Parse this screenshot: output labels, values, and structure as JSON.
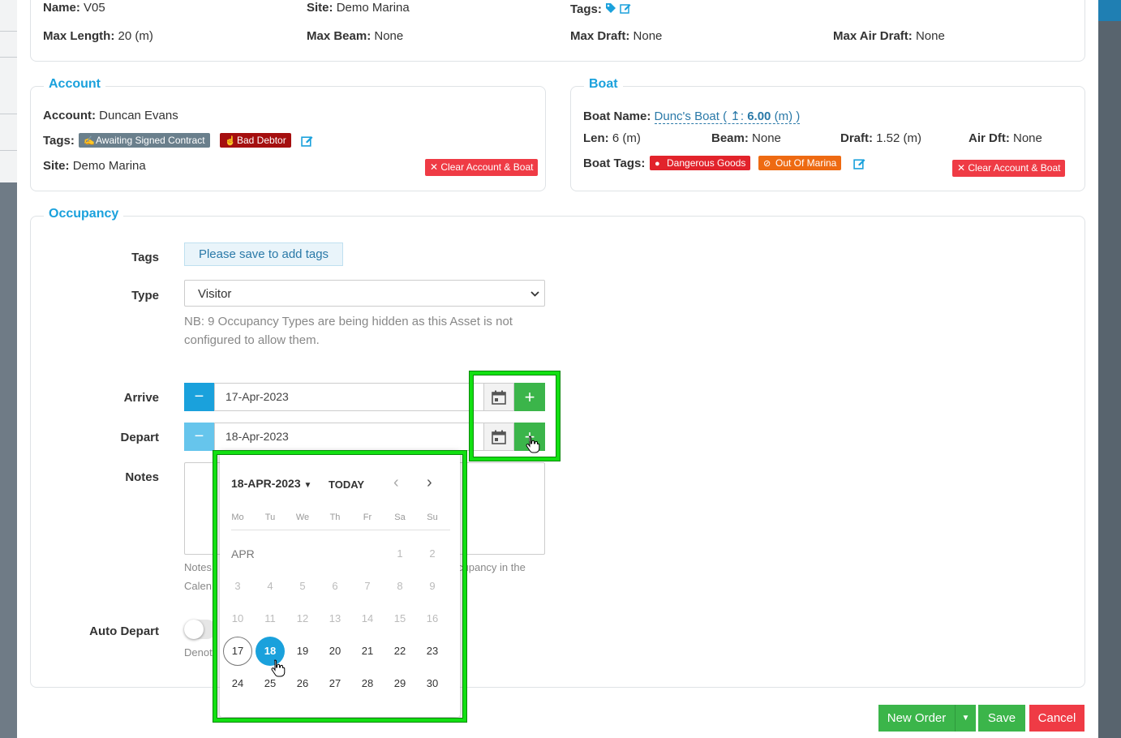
{
  "asset": {
    "name_label": "Name:",
    "name": "V05",
    "site_label": "Site:",
    "site": "Demo Marina",
    "tags_label": "Tags:",
    "max_length_label": "Max Length:",
    "max_length": "20 (m)",
    "max_beam_label": "Max Beam:",
    "max_beam": "None",
    "max_draft_label": "Max Draft:",
    "max_draft": "None",
    "max_air_draft_label": "Max Air Draft:",
    "max_air_draft": "None"
  },
  "account": {
    "legend": "Account",
    "account_label": "Account:",
    "account": "Duncan Evans",
    "tags_label": "Tags:",
    "tags": [
      {
        "text": "Awaiting Signed Contract",
        "color": "#6a7f8c"
      },
      {
        "text": "Bad Debtor",
        "color": "#a50f0f"
      }
    ],
    "site_label": "Site:",
    "site": "Demo Marina",
    "clear_button": "✕ Clear Account & Boat"
  },
  "boat": {
    "legend": "Boat",
    "boat_name_label": "Boat Name:",
    "boat_name": "Dunc's Boat (",
    "boat_name_len": "6.00",
    "boat_name_unit": "(m) )",
    "len_label": "Len:",
    "len": "6 (m)",
    "beam_label": "Beam:",
    "beam": "None",
    "draft_label": "Draft:",
    "draft": "1.52 (m)",
    "air_dft_label": "Air Dft:",
    "air_dft": "None",
    "boat_tags_label": "Boat Tags:",
    "tags": [
      {
        "text": "Dangerous Goods",
        "color": "#e2232b"
      },
      {
        "text": "Out Of Marina",
        "color": "#ee6a12"
      }
    ],
    "clear_button": "✕ Clear Account & Boat"
  },
  "occupancy": {
    "legend": "Occupancy",
    "tags_label": "Tags",
    "tags_placeholder": "Please save to add tags",
    "type_label": "Type",
    "type_value": "Visitor",
    "type_note_1": "NB: 9 Occupancy Types are being hidden as this Asset is not",
    "type_note_2": "configured to allow them.",
    "arrive_label": "Arrive",
    "arrive_value": "17-Apr-2023",
    "depart_label": "Depart",
    "depart_value": "18-Apr-2023",
    "notes_label": "Notes",
    "notes_hint_1a": "Notes",
    "notes_hint_1b": "cupancy in the",
    "notes_hint_2": "Calen",
    "auto_depart_label": "Auto Depart",
    "auto_depart_hint": "Denot"
  },
  "datepicker": {
    "month_year": "18-APR-2023",
    "today": "TODAY",
    "weekdays": [
      "Mo",
      "Tu",
      "We",
      "Th",
      "Fr",
      "Sa",
      "Su"
    ],
    "month_label": "APR",
    "weeks": [
      [
        "",
        "",
        "",
        "",
        "",
        "1",
        "2"
      ],
      [
        "3",
        "4",
        "5",
        "6",
        "7",
        "8",
        "9"
      ],
      [
        "10",
        "11",
        "12",
        "13",
        "14",
        "15",
        "16"
      ],
      [
        "17",
        "18",
        "19",
        "20",
        "21",
        "22",
        "23"
      ],
      [
        "24",
        "25",
        "26",
        "27",
        "28",
        "29",
        "30"
      ]
    ],
    "today_day": "17",
    "selected_day": "18"
  },
  "footer": {
    "new_order": "New Order",
    "save": "Save",
    "cancel": "Cancel"
  },
  "colors": {
    "accent": "#1aa1dc",
    "green": "#3bb54a",
    "red": "#ef3b45",
    "highlight": "#12e012"
  }
}
